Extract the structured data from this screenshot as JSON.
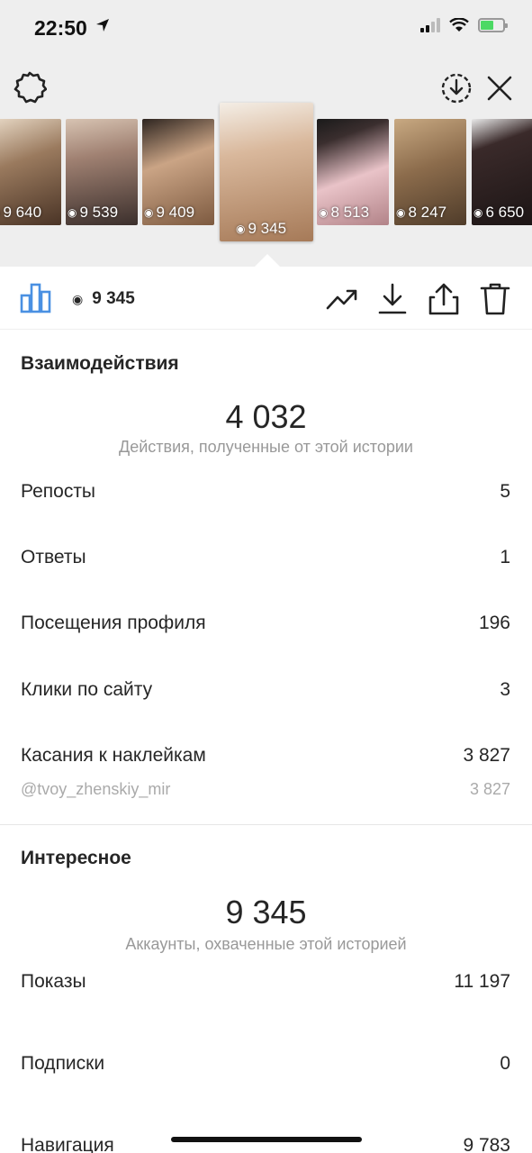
{
  "status_bar": {
    "time": "22:50",
    "icons": [
      "location-arrow-icon",
      "signal-icon",
      "wifi-icon",
      "battery-charging-icon"
    ]
  },
  "top_bar": {
    "icons": [
      "settings-icon",
      "archive-download-icon",
      "close-icon"
    ]
  },
  "thumbnails": [
    {
      "views": "9 640",
      "color": "#9a7a5e"
    },
    {
      "views": "9 539",
      "color": "#6b5a52"
    },
    {
      "views": "9 409",
      "color": "#b08866"
    },
    {
      "views": "9 345",
      "color": "#c9a68a",
      "active": true
    },
    {
      "views": "8 513",
      "color": "#c79aa2"
    },
    {
      "views": "8 247",
      "color": "#a4845f"
    },
    {
      "views": "6 650",
      "color": "#3a2a2a"
    }
  ],
  "action_row": {
    "views": "9 345",
    "icons": [
      "insights-bar-chart-icon",
      "eye-icon",
      "promote-trend-icon",
      "download-icon",
      "share-icon",
      "trash-icon"
    ]
  },
  "interactions": {
    "title": "Взаимодействия",
    "total": "4 032",
    "caption": "Действия, полученные от этой истории",
    "rows": [
      {
        "label": "Репосты",
        "value": "5"
      },
      {
        "label": "Ответы",
        "value": "1"
      },
      {
        "label": "Посещения профиля",
        "value": "196"
      },
      {
        "label": "Клики по сайту",
        "value": "3"
      },
      {
        "label": "Касания к наклейкам",
        "value": "3 827"
      }
    ],
    "sticker": {
      "label": "@tvoy_zhenskiy_mir",
      "value": "3 827"
    }
  },
  "discovery": {
    "title": "Интересное",
    "total": "9 345",
    "caption": "Аккаунты, охваченные этой историей",
    "rows": [
      {
        "label": "Показы",
        "value": "11 197"
      },
      {
        "label": "Подписки",
        "value": "0"
      },
      {
        "label": "Навигация",
        "value": "9 783"
      }
    ]
  },
  "colors": {
    "accent": "#4a90e2",
    "text": "#262626",
    "muted": "#999999",
    "top_bg": "#eeeeee"
  }
}
